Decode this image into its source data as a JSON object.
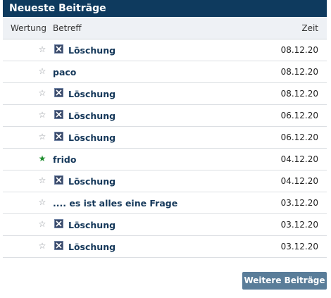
{
  "widget": {
    "title": "Neueste Beiträge",
    "columns": {
      "rating": "Wertung",
      "subject": "Betreff",
      "time": "Zeit"
    },
    "rows": [
      {
        "starred": false,
        "deleted": true,
        "subject": "Löschung",
        "date": "08.12.20"
      },
      {
        "starred": false,
        "deleted": false,
        "subject": "paco",
        "date": "08.12.20"
      },
      {
        "starred": false,
        "deleted": true,
        "subject": "Löschung",
        "date": "08.12.20"
      },
      {
        "starred": false,
        "deleted": true,
        "subject": "Löschung",
        "date": "06.12.20"
      },
      {
        "starred": false,
        "deleted": true,
        "subject": "Löschung",
        "date": "06.12.20"
      },
      {
        "starred": true,
        "deleted": false,
        "subject": "frido",
        "date": "04.12.20"
      },
      {
        "starred": false,
        "deleted": true,
        "subject": "Löschung",
        "date": "04.12.20"
      },
      {
        "starred": false,
        "deleted": false,
        "subject": ".... es ist alles eine Frage",
        "date": "03.12.20"
      },
      {
        "starred": false,
        "deleted": true,
        "subject": "Löschung",
        "date": "03.12.20"
      },
      {
        "starred": false,
        "deleted": true,
        "subject": "Löschung",
        "date": "03.12.20"
      }
    ],
    "more_button": "Weitere Beiträge"
  },
  "icons": {
    "star": "star-icon",
    "delete": "deleted-post-icon"
  },
  "colors": {
    "header_bg": "#0e3a5e",
    "star_active": "#1f8d2e",
    "button_bg": "#5a7d99"
  }
}
